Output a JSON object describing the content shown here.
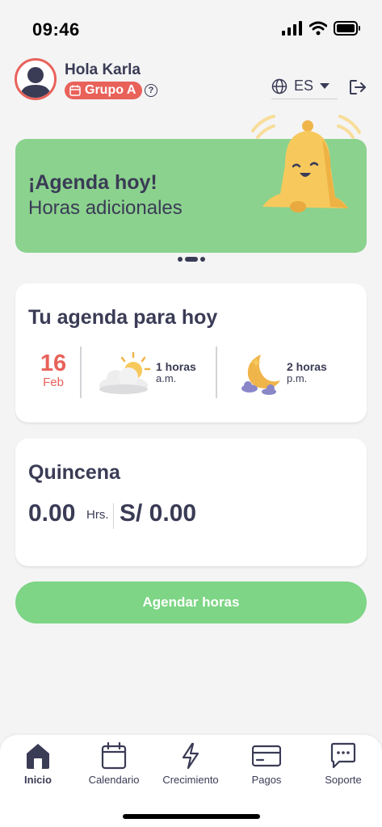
{
  "status": {
    "time": "09:46"
  },
  "header": {
    "greeting": "Hola Karla",
    "group": "Grupo A",
    "help": "?",
    "language": "ES"
  },
  "banner": {
    "title": "¡Agenda hoy!",
    "subtitle": "Horas adicionales",
    "color": "#8bd28e"
  },
  "agenda": {
    "title": "Tu agenda para hoy",
    "date": {
      "day": "16",
      "month": "Feb"
    },
    "am": {
      "hours": "1  horas",
      "period": "a.m."
    },
    "pm": {
      "hours": "2  horas",
      "period": "p.m."
    }
  },
  "quincena": {
    "title": "Quincena",
    "hours": "0.00",
    "hours_unit": "Hrs.",
    "amount": "S/ 0.00"
  },
  "cta": {
    "label": "Agendar horas",
    "color": "#7dd585"
  },
  "tabs": [
    {
      "label": "Inicio",
      "icon": "home-icon",
      "active": true
    },
    {
      "label": "Calendario",
      "icon": "calendar-icon",
      "active": false
    },
    {
      "label": "Crecimiento",
      "icon": "lightning-icon",
      "active": false
    },
    {
      "label": "Pagos",
      "icon": "card-icon",
      "active": false
    },
    {
      "label": "Soporte",
      "icon": "chat-icon",
      "active": false
    }
  ],
  "colors": {
    "accent": "#e8625a",
    "text": "#3a3b55",
    "background": "#f4f4f5"
  }
}
